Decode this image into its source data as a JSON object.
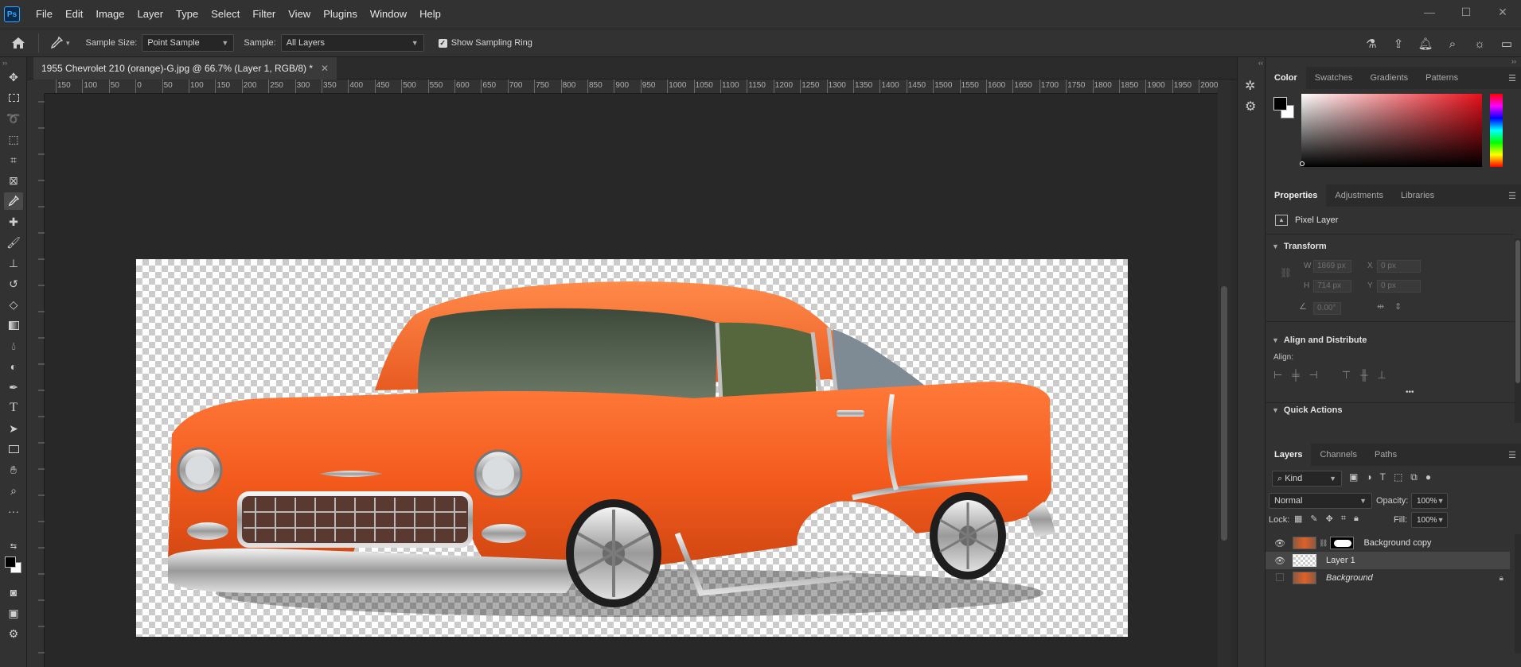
{
  "app": {
    "logo_text": "Ps"
  },
  "menu": [
    "File",
    "Edit",
    "Image",
    "Layer",
    "Type",
    "Select",
    "Filter",
    "View",
    "Plugins",
    "Window",
    "Help"
  ],
  "window_controls": {
    "minimize": "—",
    "maximize": "☐",
    "close": "✕"
  },
  "options_bar": {
    "sample_size_label": "Sample Size:",
    "sample_size_value": "Point Sample",
    "sample_label": "Sample:",
    "sample_value": "All Layers",
    "show_sampling_ring_label": "Show Sampling Ring",
    "show_sampling_ring_checked": true,
    "right_icons": [
      "flask-icon",
      "share-icon",
      "bell-icon",
      "search-icon",
      "lightbulb-icon",
      "workspace-icon"
    ]
  },
  "document": {
    "tab_title": "1955 Chevrolet 210 (orange)-G.jpg @ 66.7% (Layer 1, RGB/8) *",
    "ruler_h_labels": [
      "150",
      "100",
      "50",
      "0",
      "50",
      "100",
      "150",
      "200",
      "250",
      "300",
      "350",
      "400",
      "450",
      "500",
      "550",
      "600",
      "650",
      "700",
      "750",
      "800",
      "850",
      "900",
      "950",
      "1000",
      "1050",
      "1100",
      "1150",
      "1200",
      "1250",
      "1300",
      "1350",
      "1400",
      "1450",
      "1500",
      "1550",
      "1600",
      "1650",
      "1700",
      "1750",
      "1800",
      "1850",
      "1900",
      "1950",
      "2000"
    ]
  },
  "color_panel": {
    "tabs": [
      "Color",
      "Swatches",
      "Gradients",
      "Patterns"
    ],
    "active_tab": "Color",
    "foreground": "#000000",
    "background": "#ffffff",
    "hue": "#ff0000"
  },
  "properties_panel": {
    "tabs": [
      "Properties",
      "Adjustments",
      "Libraries"
    ],
    "active_tab": "Properties",
    "layer_type": "Pixel Layer",
    "transform_title": "Transform",
    "w_label": "W",
    "w_value": "1869 px",
    "h_label": "H",
    "h_value": "714 px",
    "x_label": "X",
    "x_value": "0 px",
    "y_label": "Y",
    "y_value": "0 px",
    "angle_value": "0.00°",
    "align_title": "Align and Distribute",
    "align_label": "Align:",
    "more": "•••",
    "quick_actions_title": "Quick Actions"
  },
  "layers_panel": {
    "tabs": [
      "Layers",
      "Channels",
      "Paths"
    ],
    "active_tab": "Layers",
    "filter_kind": "Kind",
    "blend_mode": "Normal",
    "opacity_label": "Opacity:",
    "opacity_value": "100%",
    "lock_label": "Lock:",
    "fill_label": "Fill:",
    "fill_value": "100%",
    "layers": [
      {
        "name": "Background copy",
        "visible": true,
        "selected": false,
        "has_mask": true,
        "italic": false,
        "locked": false
      },
      {
        "name": "Layer 1",
        "visible": true,
        "selected": true,
        "has_mask": false,
        "italic": false,
        "locked": false
      },
      {
        "name": "Background",
        "visible": false,
        "selected": false,
        "has_mask": false,
        "italic": true,
        "locked": true
      }
    ]
  }
}
